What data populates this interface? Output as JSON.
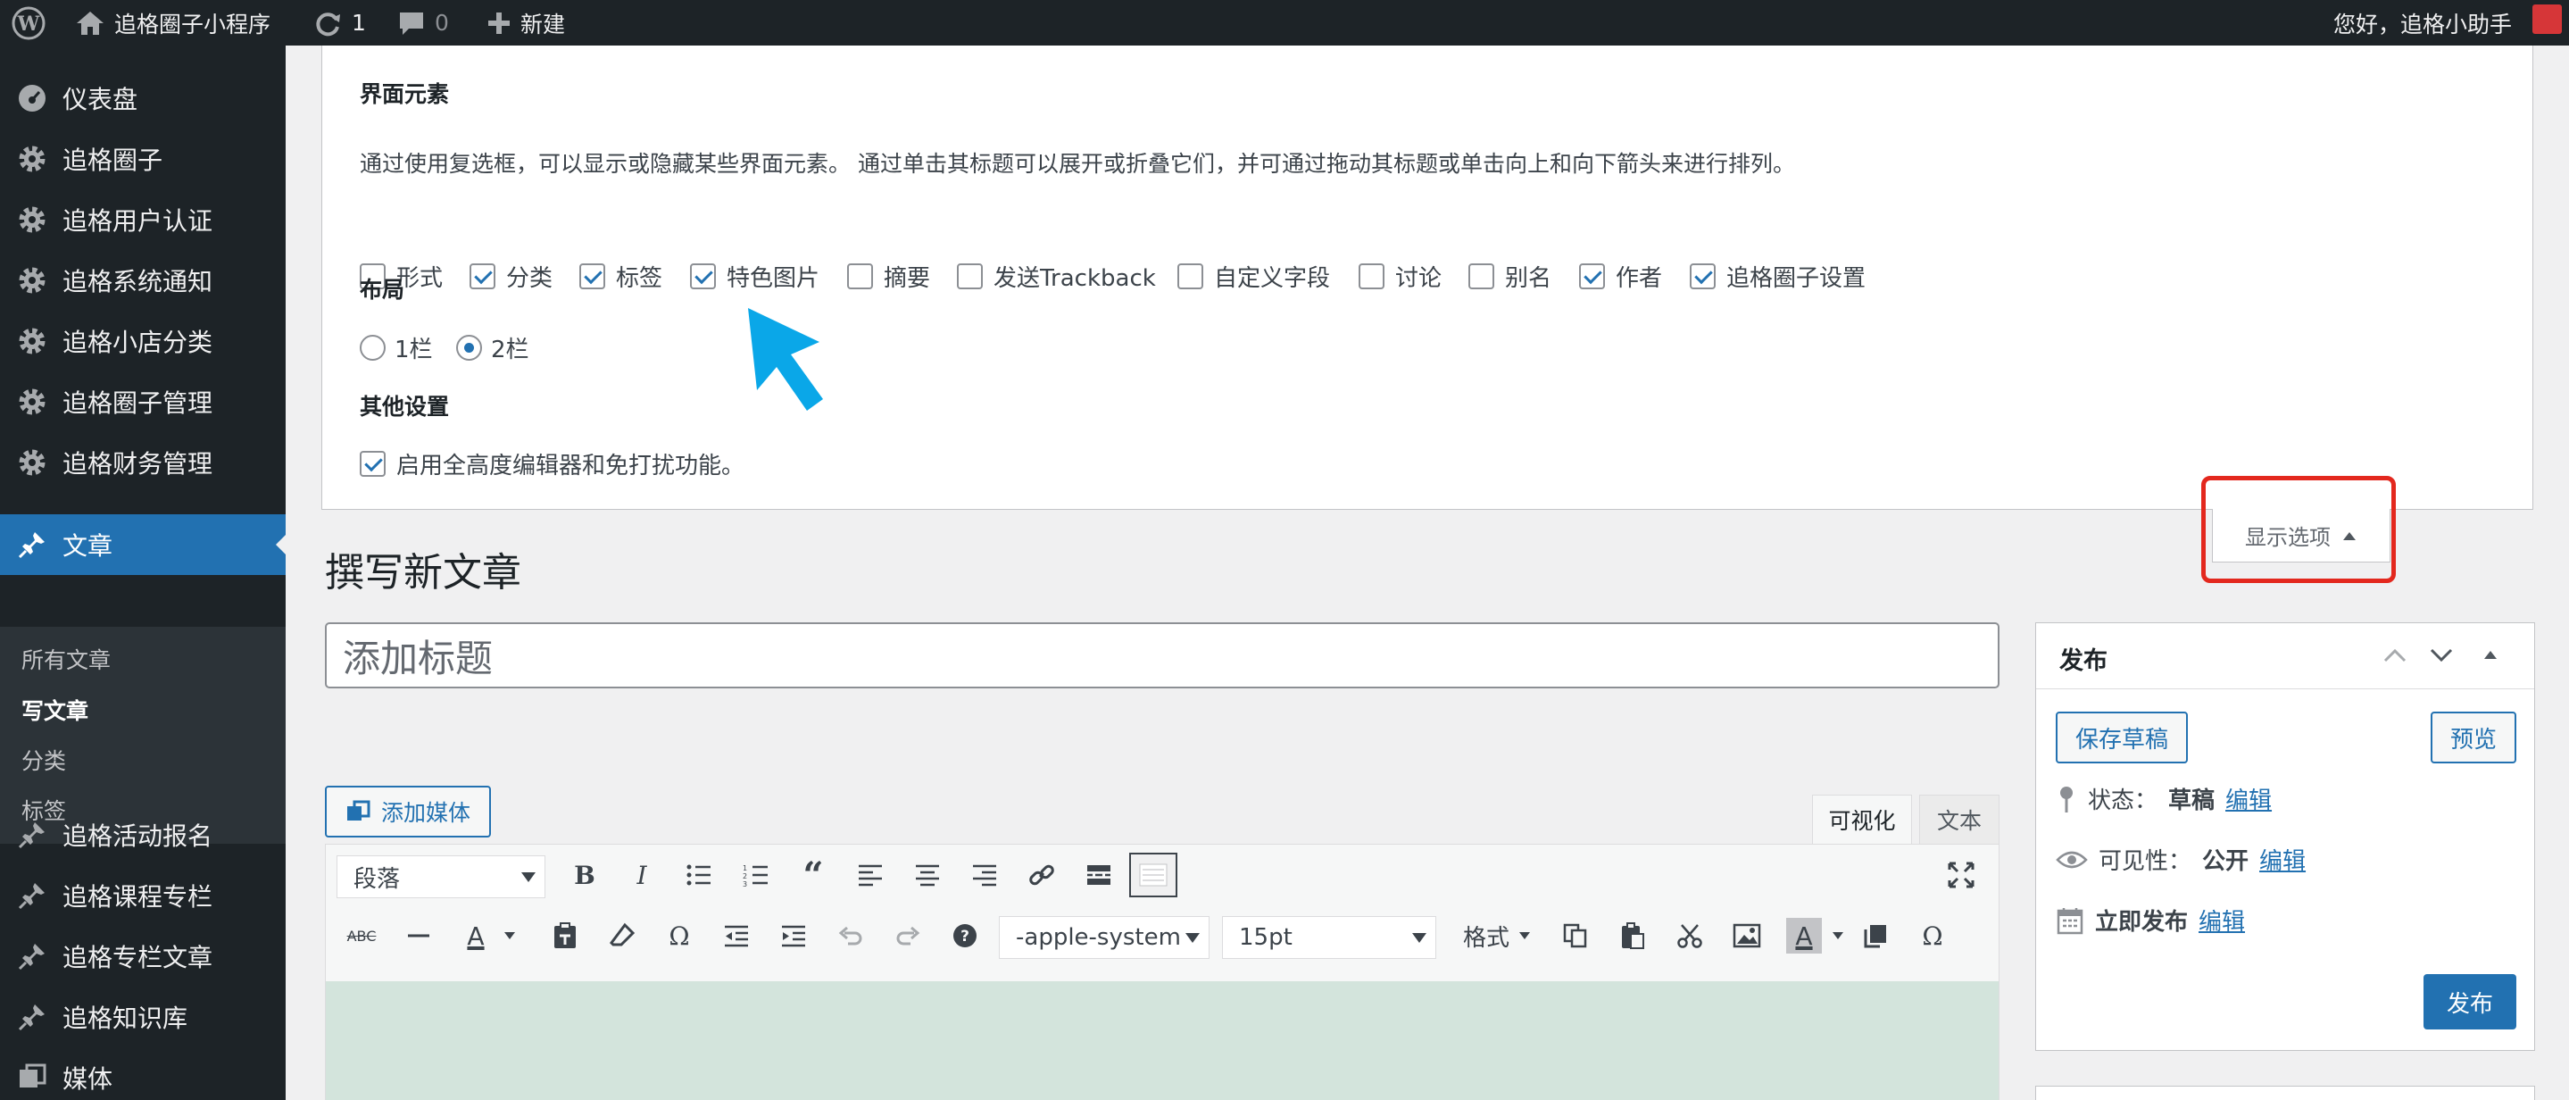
{
  "adminbar": {
    "site_name": "追格圈子小程序",
    "updates_count": "1",
    "comments_count": "0",
    "new_label": "新建",
    "greeting": "您好，追格小助手"
  },
  "sidebar": {
    "items": [
      {
        "label": "仪表盘",
        "icon": "dashboard-icon"
      },
      {
        "label": "追格圈子",
        "icon": "gear-icon"
      },
      {
        "label": "追格用户认证",
        "icon": "gear-icon"
      },
      {
        "label": "追格系统通知",
        "icon": "gear-icon"
      },
      {
        "label": "追格小店分类",
        "icon": "gear-icon"
      },
      {
        "label": "追格圈子管理",
        "icon": "gear-icon"
      },
      {
        "label": "追格财务管理",
        "icon": "gear-icon"
      },
      {
        "label": "文章",
        "icon": "pin-icon"
      },
      {
        "label": "追格活动报名",
        "icon": "pin-icon"
      },
      {
        "label": "追格课程专栏",
        "icon": "pin-icon"
      },
      {
        "label": "追格专栏文章",
        "icon": "pin-icon"
      },
      {
        "label": "追格知识库",
        "icon": "pin-icon"
      },
      {
        "label": "媒体",
        "icon": "media-icon"
      }
    ],
    "submenu": [
      "所有文章",
      "写文章",
      "分类",
      "标签"
    ]
  },
  "screen_options": {
    "section_title": "界面元素",
    "description": "通过使用复选框，可以显示或隐藏某些界面元素。 通过单击其标题可以展开或折叠它们，并可通过拖动其标题或单击向上和向下箭头来进行排列。",
    "checkboxes": [
      {
        "label": "形式",
        "checked": false
      },
      {
        "label": "分类",
        "checked": true
      },
      {
        "label": "标签",
        "checked": true
      },
      {
        "label": "特色图片",
        "checked": true
      },
      {
        "label": "摘要",
        "checked": false
      },
      {
        "label": "发送Trackback",
        "checked": false
      },
      {
        "label": "自定义字段",
        "checked": false
      },
      {
        "label": "讨论",
        "checked": false
      },
      {
        "label": "别名",
        "checked": false
      },
      {
        "label": "作者",
        "checked": true
      },
      {
        "label": "追格圈子设置",
        "checked": true
      }
    ],
    "layout_title": "布局",
    "layout_options": [
      {
        "label": "1栏",
        "checked": false
      },
      {
        "label": "2栏",
        "checked": true
      }
    ],
    "other_title": "其他设置",
    "other_option": {
      "label": "启用全高度编辑器和免打扰功能。",
      "checked": true
    },
    "toggle_label": "显示选项"
  },
  "editor": {
    "page_title": "撰写新文章",
    "title_placeholder": "添加标题",
    "add_media_label": "添加媒体",
    "tab_visual": "可视化",
    "tab_text": "文本",
    "paragraph_select": "段落",
    "font_select": "-apple-system",
    "size_select": "15pt",
    "format_menu": "格式"
  },
  "publish": {
    "title": "发布",
    "save_draft": "保存草稿",
    "preview": "预览",
    "status_label": "状态：",
    "status_value": "草稿",
    "visibility_label": "可见性：",
    "visibility_value": "公开",
    "schedule_label": "立即发布",
    "edit_link": "编辑",
    "publish_button": "发布"
  },
  "colors": {
    "admin_bg": "#1d2327",
    "accent": "#2271b1",
    "annotation_arrow": "#0aa7e8",
    "annotation_frame": "#e3281e"
  }
}
